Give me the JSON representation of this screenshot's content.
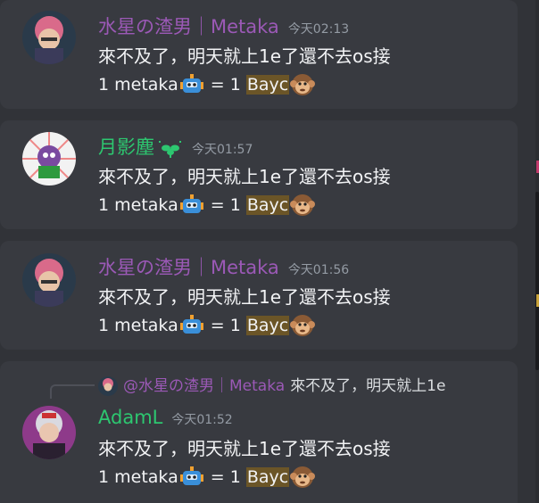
{
  "messages": [
    {
      "author": "水星の渣男｜Metaka",
      "author_color": "#9b59b6",
      "time": "今天02:13",
      "text": "來不及了，明天就上1e了還不去os接",
      "line2": {
        "prefix": "1 metaka",
        "eq": " = 1 ",
        "hl": "Bayc"
      }
    },
    {
      "author": "月影塵",
      "author_color": "#2dc770",
      "time": "今天01:57",
      "text": "來不及了，明天就上1e了還不去os接",
      "line2": {
        "prefix": "1 metaka",
        "eq": " = 1 ",
        "hl": "Bayc"
      }
    },
    {
      "author": "水星の渣男｜Metaka",
      "author_color": "#9b59b6",
      "time": "今天01:56",
      "text": "來不及了，明天就上1e了還不去os接",
      "line2": {
        "prefix": "1 metaka",
        "eq": " = 1 ",
        "hl": "Bayc"
      }
    },
    {
      "reply": {
        "author": "@水星の渣男｜Metaka",
        "text": "來不及了，明天就上1e"
      },
      "author": "AdamL",
      "author_color": "#2dc770",
      "time": "今天01:52",
      "text": "來不及了，明天就上1e了還不去os接",
      "line2": {
        "prefix": "1 metaka",
        "eq": " = 1 ",
        "hl": "Bayc"
      }
    }
  ],
  "icons": {
    "robot": "robot-emoji",
    "monkey": "monkey-emoji",
    "badge": "plant-badge-icon"
  }
}
